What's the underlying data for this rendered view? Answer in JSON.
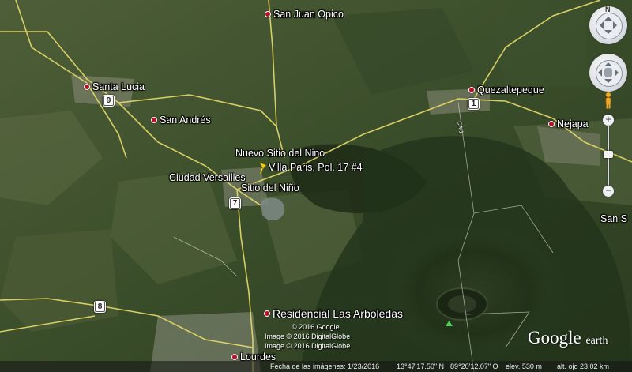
{
  "places": [
    {
      "label": "San Juan Opico",
      "dot": true
    },
    {
      "label": "Santa Lucia",
      "dot": true
    },
    {
      "label": "San Andrés",
      "dot": true
    },
    {
      "label": "Quezaltepeque",
      "dot": true
    },
    {
      "label": "Nejapa",
      "dot": true
    },
    {
      "label": "Nuevo Sitio del Nino",
      "dot": false
    },
    {
      "label": "Villa Paris, Pol. 17 #4",
      "dot": false
    },
    {
      "label": "Ciudad Versailles",
      "dot": false
    },
    {
      "label": "Sitio del Niño",
      "dot": false
    },
    {
      "label": "San S",
      "dot": false
    },
    {
      "label": "Residencial Las Arboledas",
      "dot": true
    },
    {
      "label": "Lourdes",
      "dot": true
    }
  ],
  "routes": [
    "9",
    "1",
    "7",
    "8"
  ],
  "road_label": "CA-1",
  "credits": [
    "© 2016 Google",
    "Image © 2016 DigitalGlobe",
    "Image © 2016 DigitalGlobe"
  ],
  "status": {
    "imagery_date": "Fecha de las imágenes: 1/23/2016",
    "latitude": "13°47'17.50\" N",
    "longitude": "89°20'12.07\" O",
    "elevation": "elev.  530 m",
    "eye_altitude": "alt. ojo  23.02 km"
  },
  "logo": {
    "word1": "Google",
    "word2": "earth"
  },
  "controls": {
    "north_letter": "N",
    "zoom_in": "+",
    "zoom_out": "−"
  },
  "colors": {
    "road": "#e8dc6a",
    "marker": "#b8102a",
    "pin": "#f4d21c"
  }
}
